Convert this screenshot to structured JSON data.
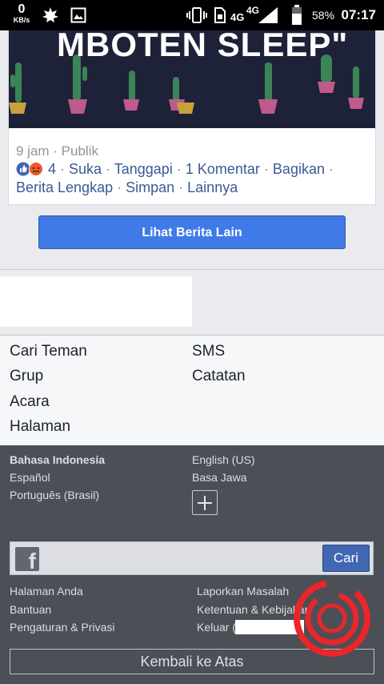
{
  "status_bar": {
    "net_speed": "0",
    "net_unit": "KB/s",
    "network_1": "4G",
    "network_2": "4G",
    "battery": "58%",
    "time": "07:17"
  },
  "post": {
    "banner_text": "MBOTEN SLEEP\"",
    "meta": "9 jam · Publik",
    "reaction_count": "4",
    "actions": [
      "Suka",
      "Tanggapi",
      "1 Komentar",
      "Bagikan",
      "Berita Lengkap",
      "Simpan",
      "Lainnya"
    ]
  },
  "more_button": "Lihat Berita Lain",
  "nav_links": {
    "left": [
      "Cari Teman",
      "Grup",
      "Acara",
      "Halaman"
    ],
    "right": [
      "SMS",
      "Catatan"
    ]
  },
  "languages": {
    "current": "Bahasa Indonesia",
    "others": [
      "English (US)",
      "Español",
      "Basa Jawa",
      "Português (Brasil)"
    ]
  },
  "search": {
    "button_label": "Cari",
    "value": ""
  },
  "footer_links": {
    "left": [
      "Halaman Anda",
      "Bantuan",
      "Pengaturan & Privasi"
    ],
    "right": [
      "Laporkan Masalah",
      "Ketentuan & Kebijakan",
      "Keluar ("
    ]
  },
  "back_to_top": "Kembali ke Atas",
  "colors": {
    "fb_blue": "#3b5998",
    "button_blue": "#4267b2",
    "footer_bg": "#4b4f56",
    "watermark_red": "#e8262b"
  }
}
